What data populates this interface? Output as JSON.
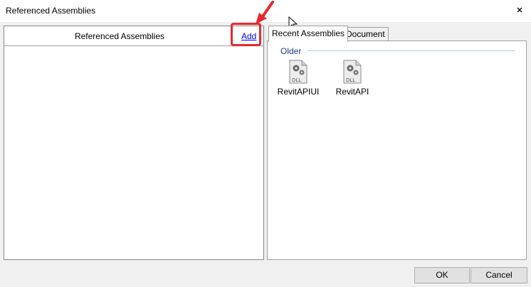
{
  "window": {
    "title": "Referenced Assemblies",
    "close_label": "x"
  },
  "left_panel": {
    "header": "Referenced Assemblies",
    "add_label": "Add"
  },
  "tabs": [
    {
      "label": "Recent Assemblies",
      "active": true
    },
    {
      "label": "Document",
      "active": false
    }
  ],
  "recent": {
    "group_label": "Older",
    "items": [
      {
        "name": "RevitAPIUI",
        "icon": "dll-gear-icon",
        "icon_text": "DLL"
      },
      {
        "name": "RevitAPI",
        "icon": "dll-gear-icon",
        "icon_text": "DLL"
      }
    ]
  },
  "buttons": {
    "ok": "OK",
    "cancel": "Cancel"
  },
  "colors": {
    "highlight": "#e8282b",
    "link": "#0000ee",
    "group_label": "#1e3c88"
  }
}
